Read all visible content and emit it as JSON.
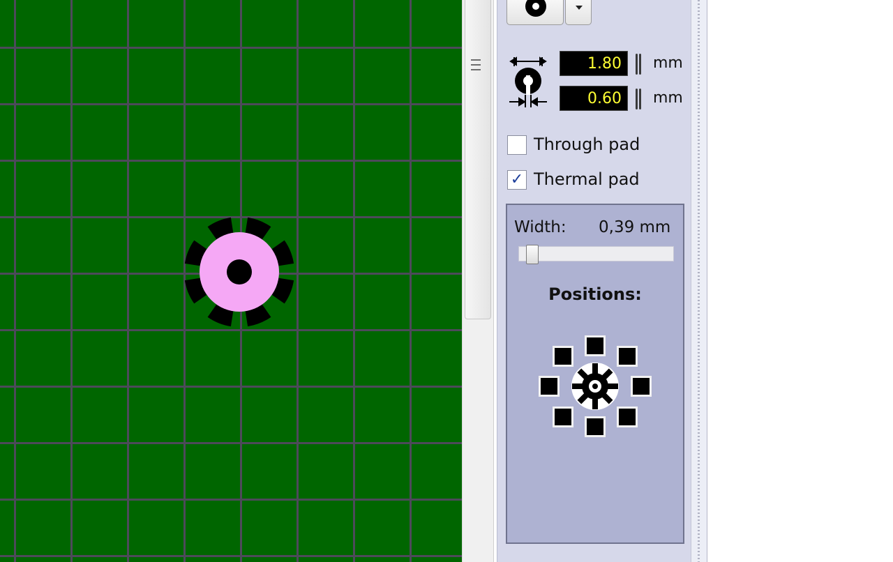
{
  "pad_size": {
    "value": "1.80",
    "unit": "mm"
  },
  "hole_size": {
    "value": "0.60",
    "unit": "mm"
  },
  "through_pad": {
    "label": "Through pad",
    "checked": false
  },
  "thermal_pad": {
    "label": "Thermal pad",
    "checked": true,
    "check_mark": "✓"
  },
  "thermal": {
    "width_label": "Width:",
    "width_value": "0,39 mm",
    "width_slider_position": 0.1,
    "positions_label": "Positions:",
    "positions": [
      "top",
      "top-right",
      "right",
      "bottom-right",
      "bottom",
      "bottom-left",
      "left",
      "top-left"
    ]
  },
  "colors": {
    "board": "#006600",
    "grid": "#4d4a5a",
    "pad": "#f5a8f5",
    "field_text": "#ffff33"
  }
}
